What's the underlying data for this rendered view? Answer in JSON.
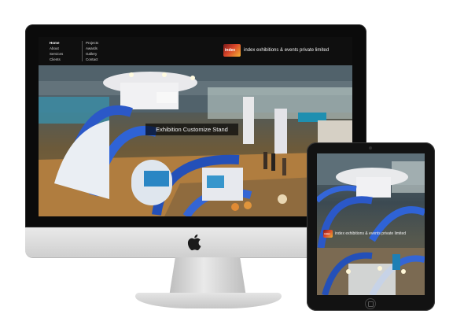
{
  "site": {
    "nav_col1": [
      "Home",
      "About",
      "Services",
      "Clients"
    ],
    "nav_col2": [
      "Projects",
      "Awards",
      "Gallery",
      "Contact"
    ],
    "brand_name": "index exhibitions & events private limited",
    "brand_mark": "index",
    "hero_caption": "Exhibition Customize Stand"
  },
  "colors": {
    "ring_blue": "#2b58c8",
    "brand_orange": "#d9452a",
    "header_bg": "#0f0f0f"
  },
  "icons": {
    "apple": "apple-logo-icon"
  }
}
